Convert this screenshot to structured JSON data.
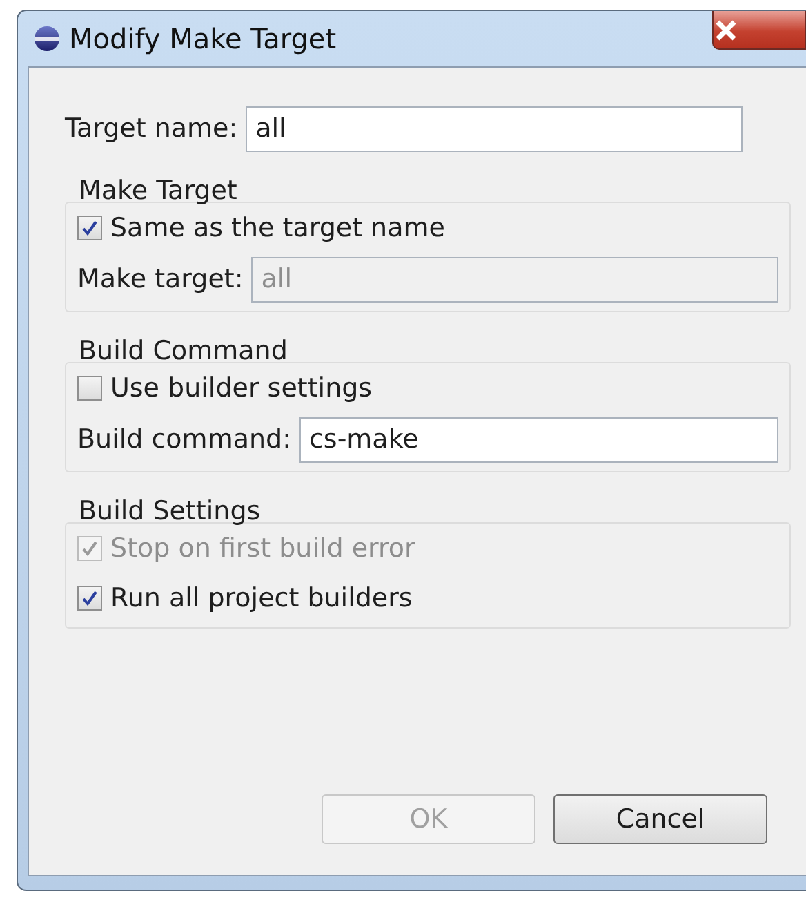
{
  "window": {
    "title": "Modify Make Target"
  },
  "target_name": {
    "label": "Target name:",
    "value": "all"
  },
  "groups": [
    {
      "title": "Make Target",
      "items": [
        {
          "kind": "checkbox",
          "label": "Same as the target name",
          "checked": true,
          "disabled": false
        },
        {
          "kind": "field",
          "label": "Make target:",
          "value": "all",
          "disabled": true
        }
      ]
    },
    {
      "title": "Build Command",
      "items": [
        {
          "kind": "checkbox",
          "label": "Use builder settings",
          "checked": false,
          "disabled": false
        },
        {
          "kind": "field",
          "label": "Build command:",
          "value": "cs-make",
          "disabled": false
        }
      ]
    },
    {
      "title": "Build Settings",
      "items": [
        {
          "kind": "checkbox",
          "label": "Stop on first build error",
          "checked": true,
          "disabled": true
        },
        {
          "kind": "checkbox",
          "label": "Run all project builders",
          "checked": true,
          "disabled": false
        }
      ]
    }
  ],
  "buttons": [
    {
      "label": "OK",
      "disabled": true
    },
    {
      "label": "Cancel",
      "disabled": false
    }
  ]
}
